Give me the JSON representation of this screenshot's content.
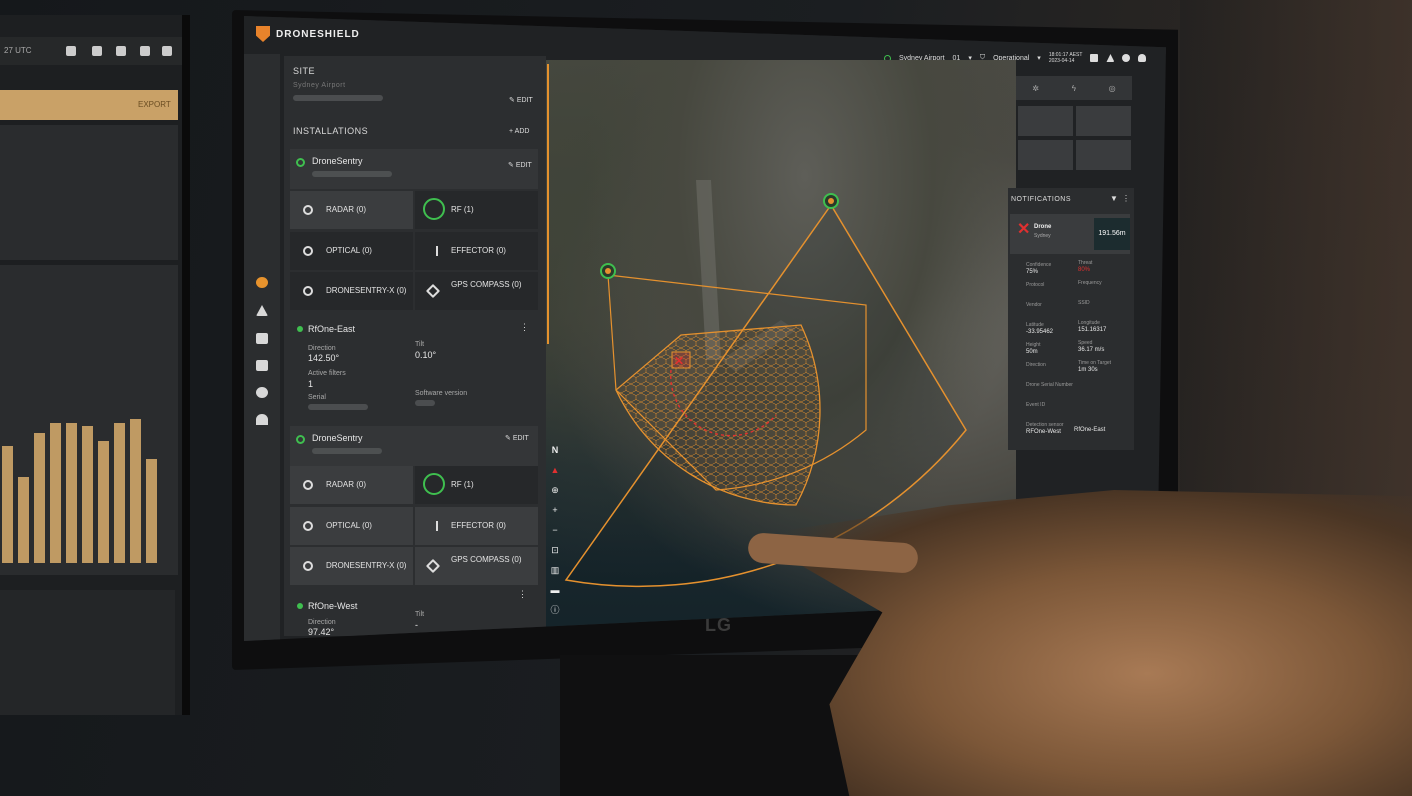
{
  "left_monitor": {
    "clock": "27 UTC",
    "export_label": "EXPORT",
    "bar_values": [
      0.65,
      0.48,
      0.72,
      0.78,
      0.78,
      0.76,
      0.68,
      0.78,
      0.8,
      0.58
    ]
  },
  "header": {
    "brand": "DRONESHIELD",
    "site_selector": "Sydney Airport",
    "site_number": "01",
    "status": "Operational",
    "time": "18:01:17 AEST",
    "date": "2023-04-14"
  },
  "panel": {
    "site_label": "SITE",
    "site_name": "Sydney Airport",
    "edit_label": "EDIT",
    "installations_label": "INSTALLATIONS",
    "add_label": "ADD",
    "installations": [
      {
        "name": "DroneSentry",
        "sensors": [
          {
            "label": "RADAR (0)",
            "icon": "radar-icon"
          },
          {
            "label": "RF (1)",
            "icon": "rf-icon"
          },
          {
            "label": "OPTICAL (0)",
            "icon": "optical-icon"
          },
          {
            "label": "EFFECTOR (0)",
            "icon": "effector-icon"
          },
          {
            "label": "DRONESENTRY-X (0)",
            "icon": "wifi-icon"
          },
          {
            "label": "GPS COMPASS (0)",
            "icon": "compass-icon"
          }
        ],
        "rf_sensor": {
          "name": "RfOne-East",
          "direction_label": "Direction",
          "direction": "142.50°",
          "tilt_label": "Tilt",
          "tilt": "0.10°",
          "filters_label": "Active filters",
          "filters": "1",
          "serial_label": "Serial",
          "software_label": "Software version"
        }
      },
      {
        "name": "DroneSentry",
        "sensors": [
          {
            "label": "RADAR (0)",
            "icon": "radar-icon"
          },
          {
            "label": "RF (1)",
            "icon": "rf-icon"
          },
          {
            "label": "OPTICAL (0)",
            "icon": "optical-icon"
          },
          {
            "label": "EFFECTOR (0)",
            "icon": "effector-icon"
          },
          {
            "label": "DRONESENTRY-X (0)",
            "icon": "wifi-icon"
          },
          {
            "label": "GPS COMPASS (0)",
            "icon": "compass-icon"
          }
        ],
        "rf_sensor": {
          "name": "RfOne-West",
          "direction_label": "Direction",
          "direction": "97.42°",
          "tilt_label": "Tilt",
          "tilt": "-"
        }
      }
    ]
  },
  "map_controls": [
    "N",
    "▲",
    "⊕",
    "+",
    "−",
    "⊡",
    "▥",
    "▬",
    "ⓘ"
  ],
  "notifications": {
    "title": "NOTIFICATIONS",
    "card": {
      "title": "Drone",
      "subtitle": "Sydney",
      "distance": "191.56m"
    },
    "fields": {
      "confidence_label": "Confidence",
      "confidence": "75%",
      "threat_label": "Threat",
      "threat": "80%",
      "protocol_label": "Protocol",
      "frequency_label": "Frequency",
      "vendor_label": "Vendor",
      "ssid_label": "SSID",
      "latitude_label": "Latitude",
      "latitude": "-33.95462",
      "longitude_label": "Longitude",
      "longitude": "151.16317",
      "height_label": "Height",
      "height": "50m",
      "speed_label": "Speed",
      "speed": "36.17 m/s",
      "direction_label": "Direction",
      "time_label": "Time on Target",
      "time": "1m 30s",
      "serial_label": "Drone Serial Number",
      "event_label": "Event ID",
      "detection_label": "Detection sensor",
      "sensor_west": "RFOne-West",
      "sensor_east": "RfOne-East"
    }
  },
  "monitor_brand": "LG",
  "colors": {
    "accent": "#e5912e",
    "ok": "#3fbf4f",
    "threat": "#e03030"
  }
}
